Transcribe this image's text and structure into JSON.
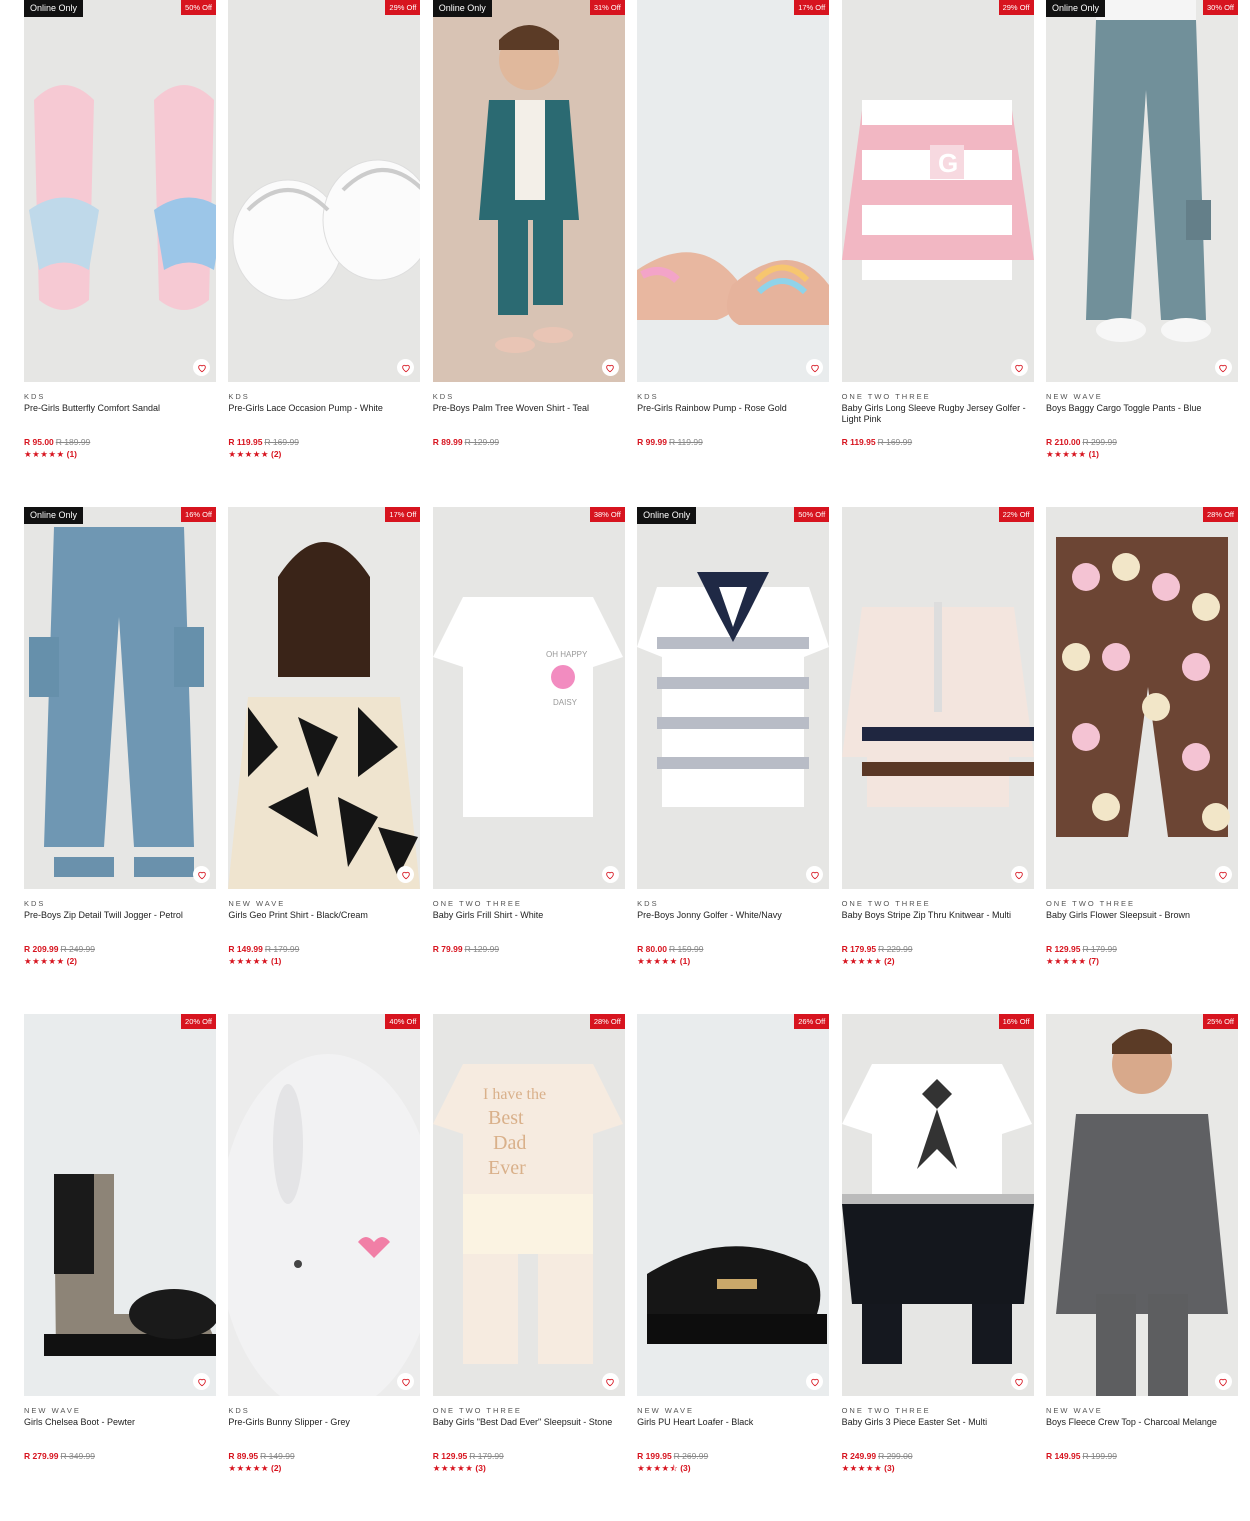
{
  "online_label": "Online Only",
  "products": [
    {
      "brand": "KDS",
      "title": "Pre-Girls Butterfly Comfort Sandal",
      "price": "R 95.00",
      "was": "R 189.99",
      "discount": "50% Off",
      "online": true,
      "stars": "★★★★★",
      "reviews": "(1)",
      "img": "sandal",
      "bg": "#e6e6e4"
    },
    {
      "brand": "KDS",
      "title": "Pre-Girls Lace Occasion Pump - White",
      "price": "R 119.95",
      "was": "R 169.99",
      "discount": "29% Off",
      "online": false,
      "stars": "★★★★★",
      "reviews": "(2)",
      "img": "pump-white",
      "bg": "#e6e6e4"
    },
    {
      "brand": "KDS",
      "title": "Pre-Boys Palm Tree Woven Shirt - Teal",
      "price": "R 89.99",
      "was": "R 129.99",
      "discount": "31% Off",
      "online": true,
      "stars": "",
      "reviews": "",
      "img": "boy-shirt",
      "bg": "#d8c3b4"
    },
    {
      "brand": "KDS",
      "title": "Pre-Girls Rainbow Pump - Rose Gold",
      "price": "R 99.99",
      "was": "R 119.99",
      "discount": "17% Off",
      "online": false,
      "stars": "",
      "reviews": "",
      "img": "pump-rose",
      "bg": "#e9eced"
    },
    {
      "brand": "ONE TWO THREE",
      "title": "Baby Girls Long Sleeve Rugby Jersey Golfer - Light Pink",
      "price": "R 119.95",
      "was": "R 169.99",
      "discount": "29% Off",
      "online": false,
      "stars": "",
      "reviews": "",
      "img": "rugby",
      "bg": "#e6e6e4"
    },
    {
      "brand": "NEW WAVE",
      "title": "Boys Baggy Cargo Toggle Pants - Blue",
      "price": "R 210.00",
      "was": "R 299.99",
      "discount": "30% Off",
      "online": true,
      "stars": "★★★★★",
      "reviews": "(1)",
      "img": "cargo-pants",
      "bg": "#e8e8e6"
    },
    {
      "brand": "KDS",
      "title": "Pre-Boys Zip Detail Twill Jogger - Petrol",
      "price": "R 209.99",
      "was": "R 249.99",
      "discount": "16% Off",
      "online": true,
      "stars": "★★★★★",
      "reviews": "(2)",
      "img": "jogger",
      "bg": "#e6e6e4"
    },
    {
      "brand": "NEW WAVE",
      "title": "Girls Geo Print Shirt - Black/Cream",
      "price": "R 149.99",
      "was": "R 179.99",
      "discount": "17% Off",
      "online": false,
      "stars": "★★★★★",
      "reviews": "(1)",
      "img": "geo-shirt",
      "bg": "#e8e8e6"
    },
    {
      "brand": "ONE TWO THREE",
      "title": "Baby Girls Frill Shirt - White",
      "price": "R 79.99",
      "was": "R 129.99",
      "discount": "38% Off",
      "online": false,
      "stars": "",
      "reviews": "",
      "img": "frill-shirt",
      "bg": "#e6e6e4"
    },
    {
      "brand": "KDS",
      "title": "Pre-Boys Jonny Golfer - White/Navy",
      "price": "R 80.00",
      "was": "R 159.99",
      "discount": "50% Off",
      "online": true,
      "stars": "★★★★★",
      "reviews": "(1)",
      "img": "golfer",
      "bg": "#e6e6e4"
    },
    {
      "brand": "ONE TWO THREE",
      "title": "Baby Boys Stripe Zip Thru Knitwear - Multi",
      "price": "R 179.95",
      "was": "R 229.99",
      "discount": "22% Off",
      "online": false,
      "stars": "★★★★★",
      "reviews": "(2)",
      "img": "knitwear",
      "bg": "#e6e6e4"
    },
    {
      "brand": "ONE TWO THREE",
      "title": "Baby Girls Flower Sleepsuit - Brown",
      "price": "R 129.95",
      "was": "R 179.99",
      "discount": "28% Off",
      "online": false,
      "stars": "★★★★★",
      "reviews": "(7)",
      "img": "flower-suit",
      "bg": "#e6e6e4"
    },
    {
      "brand": "NEW WAVE",
      "title": "Girls Chelsea Boot - Pewter",
      "price": "R 279.99",
      "was": "R 349.99",
      "discount": "20% Off",
      "online": false,
      "stars": "",
      "reviews": "",
      "img": "chelsea",
      "bg": "#e9eced"
    },
    {
      "brand": "KDS",
      "title": "Pre-Girls Bunny Slipper - Grey",
      "price": "R 89.95",
      "was": "R 149.99",
      "discount": "40% Off",
      "online": false,
      "stars": "★★★★★",
      "reviews": "(2)",
      "img": "bunny",
      "bg": "#ececec"
    },
    {
      "brand": "ONE TWO THREE",
      "title": "Baby Girls \"Best Dad Ever\" Sleepsuit - Stone",
      "price": "R 129.95",
      "was": "R 179.99",
      "discount": "28% Off",
      "online": false,
      "stars": "★★★★★",
      "reviews": "(3)",
      "img": "dad-suit",
      "bg": "#e6e6e4"
    },
    {
      "brand": "NEW WAVE",
      "title": "Girls PU Heart Loafer - Black",
      "price": "R 199.95",
      "was": "R 269.99",
      "discount": "26% Off",
      "online": false,
      "stars": "★★★★⯪",
      "reviews": "(3)",
      "img": "loafer",
      "bg": "#e9eced"
    },
    {
      "brand": "ONE TWO THREE",
      "title": "Baby Girls 3 Piece Easter Set - Multi",
      "price": "R 249.99",
      "was": "R 299.00",
      "discount": "16% Off",
      "online": false,
      "stars": "★★★★★",
      "reviews": "(3)",
      "img": "easter-set",
      "bg": "#e6e6e4"
    },
    {
      "brand": "NEW WAVE",
      "title": "Boys Fleece Crew Top - Charcoal Melange",
      "price": "R 149.95",
      "was": "R 199.99",
      "discount": "25% Off",
      "online": false,
      "stars": "",
      "reviews": "",
      "img": "fleece-boy",
      "bg": "#e8e8e6"
    }
  ]
}
